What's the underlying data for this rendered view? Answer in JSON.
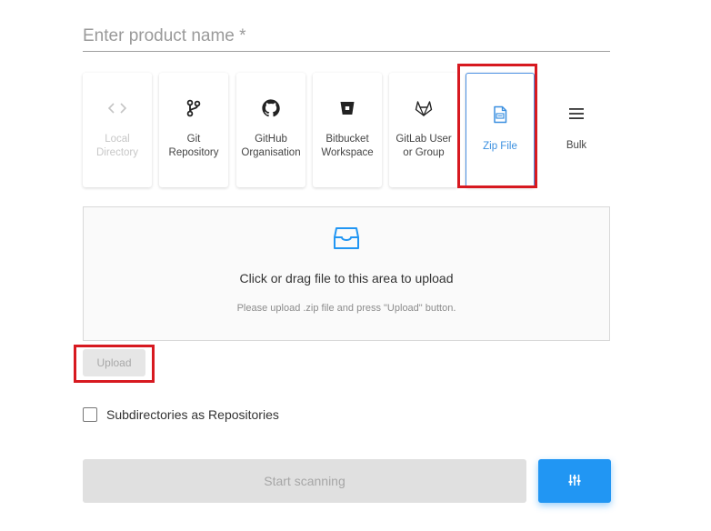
{
  "product": {
    "placeholder": "Enter product name *",
    "value": ""
  },
  "sources": [
    {
      "id": "local",
      "label": "Local\nDirectory",
      "icon": "code-icon",
      "state": "disabled"
    },
    {
      "id": "git",
      "label": "Git\nRepository",
      "icon": "git-branch-icon",
      "state": "normal"
    },
    {
      "id": "github",
      "label": "GitHub\nOrganisation",
      "icon": "github-icon",
      "state": "normal"
    },
    {
      "id": "bitbucket",
      "label": "Bitbucket\nWorkspace",
      "icon": "bitbucket-icon",
      "state": "normal"
    },
    {
      "id": "gitlab",
      "label": "GitLab User\nor Group",
      "icon": "gitlab-icon",
      "state": "normal"
    },
    {
      "id": "zip",
      "label": "Zip File",
      "icon": "zip-file-icon",
      "state": "selected"
    },
    {
      "id": "bulk",
      "label": "Bulk",
      "icon": "menu-icon",
      "state": "normal"
    }
  ],
  "dropzone": {
    "icon": "inbox-icon",
    "title": "Click or drag file to this area to upload",
    "hint": "Please upload .zip file and press \"Upload\" button."
  },
  "upload": {
    "label": "Upload",
    "disabled": true
  },
  "subdirectories": {
    "label": "Subdirectories as Repositories",
    "checked": false
  },
  "scan": {
    "label": "Start scanning",
    "disabled": true
  },
  "settings": {
    "icon": "sliders-icon"
  },
  "colors": {
    "accent": "#2196f3",
    "selected": "#4a90e2",
    "highlight": "#d71920",
    "disabled_bg": "#e0e0e0"
  }
}
